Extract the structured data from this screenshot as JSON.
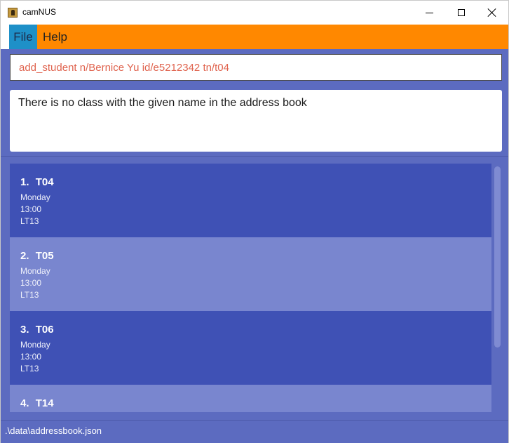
{
  "window": {
    "title": "camNUS",
    "icon": "address-book-icon"
  },
  "menu": {
    "items": [
      {
        "label": "File"
      },
      {
        "label": "Help"
      }
    ]
  },
  "command_box": {
    "value": "add_student n/Bernice Yu id/e5212342 tn/t04"
  },
  "result_display": {
    "text": "There is no class with the given name in the address book"
  },
  "class_list": {
    "items": [
      {
        "index": "1.",
        "name": "T04",
        "day": "Monday",
        "time": "13:00",
        "venue": "LT13"
      },
      {
        "index": "2.",
        "name": "T05",
        "day": "Monday",
        "time": "13:00",
        "venue": "LT13"
      },
      {
        "index": "3.",
        "name": "T06",
        "day": "Monday",
        "time": "13:00",
        "venue": "LT13"
      },
      {
        "index": "4.",
        "name": "T14",
        "day": "",
        "time": "",
        "venue": ""
      }
    ]
  },
  "status_bar": {
    "path": ".\\data\\addressbook.json"
  },
  "colors": {
    "menu_bar": "#ff8800",
    "active_menu": "#1e90c8",
    "background": "#5c6bc0",
    "card_dark": "#3f51b5",
    "card_light": "#7986cf",
    "command_text": "#e0644f"
  }
}
